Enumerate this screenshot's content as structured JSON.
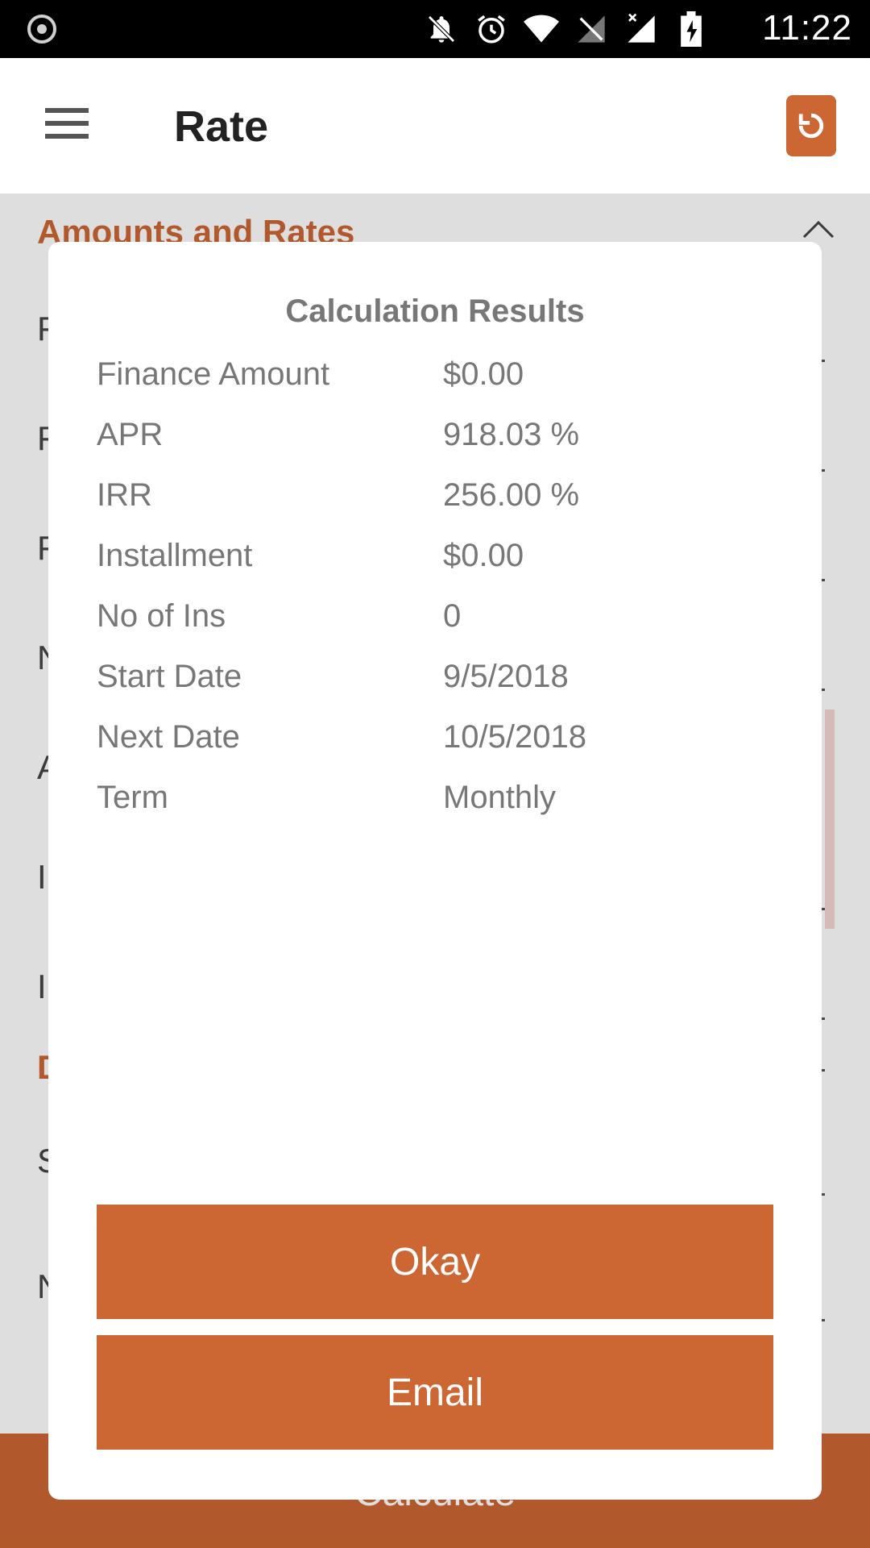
{
  "status_bar": {
    "time": "11:22"
  },
  "app_bar": {
    "title": "Rate"
  },
  "background": {
    "section_title": "Amounts and Rates",
    "row_initials": [
      "F",
      "F",
      "F",
      "N",
      "A",
      "I",
      "I",
      "D",
      "S",
      "N"
    ],
    "bottom_button": "Calculate"
  },
  "dialog": {
    "title": "Calculation Results",
    "results": [
      {
        "label": "Finance Amount",
        "value": "$0.00"
      },
      {
        "label": "APR",
        "value": "918.03 %"
      },
      {
        "label": "IRR",
        "value": "256.00 %"
      },
      {
        "label": "Installment",
        "value": "$0.00"
      },
      {
        "label": "No of Ins",
        "value": "0"
      },
      {
        "label": "Start Date",
        "value": "9/5/2018"
      },
      {
        "label": "Next Date",
        "value": "10/5/2018"
      },
      {
        "label": "Term",
        "value": "Monthly"
      }
    ],
    "okay_label": "Okay",
    "email_label": "Email"
  },
  "colors": {
    "accent": "#cc6633",
    "status_bar": "#000000",
    "text_muted": "#777777"
  },
  "icons": {
    "menu": "hamburger-menu-icon",
    "reset": "reset-document-icon",
    "chevron": "chevron-up-icon"
  }
}
